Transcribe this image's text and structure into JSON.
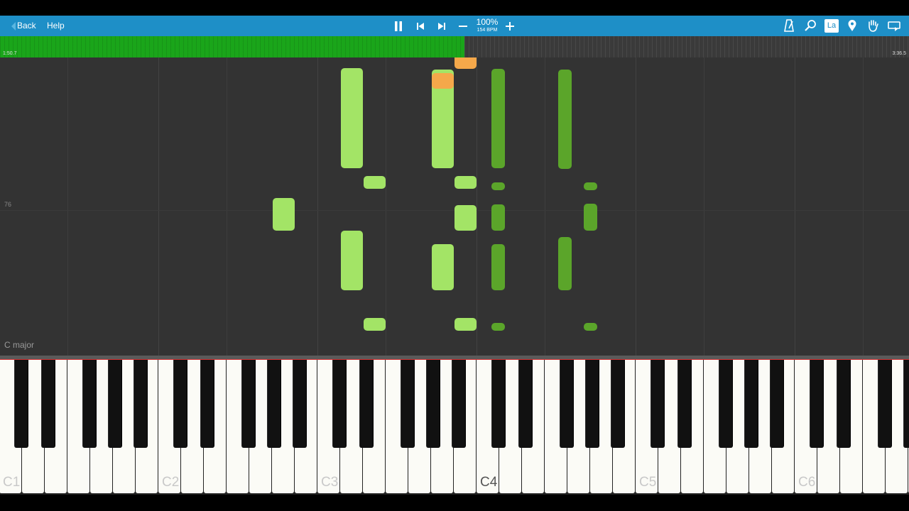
{
  "toolbar": {
    "back_label": "Back",
    "help_label": "Help",
    "zoom_percent": "100%",
    "tempo": "154 BPM",
    "icons": [
      "pause-icon",
      "skip-back-icon",
      "skip-forward-icon",
      "minus-icon",
      "plus-icon",
      "metronome-icon",
      "search-icon",
      "label-icon",
      "location-pin-icon",
      "hand-icon",
      "loop-icon"
    ],
    "label_toggle": "La"
  },
  "progress": {
    "elapsed": "1:50.7",
    "total": "3:36.5",
    "fraction": 0.511,
    "color": "#1aa51a"
  },
  "roll": {
    "pitch_marker": "76",
    "key_signature": "C major",
    "note_colors": {
      "light": "#a3e466",
      "dark": "#5ba52a",
      "active": "#f5a84a"
    }
  },
  "keyboard": {
    "octave_labels": [
      "C1",
      "C2",
      "C3",
      "C4",
      "C5",
      "C6"
    ],
    "highlighted_label": "C4"
  }
}
